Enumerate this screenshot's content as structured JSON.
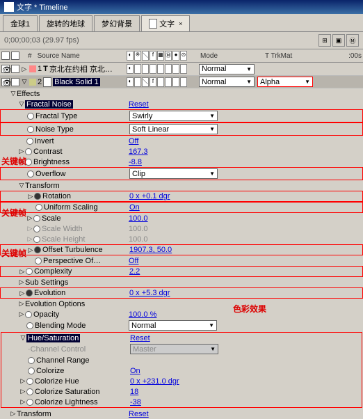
{
  "window": {
    "title": "文字 * Timeline"
  },
  "tabs": [
    {
      "label": "金球1"
    },
    {
      "label": "旋转的地球"
    },
    {
      "label": "梦幻背景"
    },
    {
      "label": "文字",
      "active": true
    }
  ],
  "timecode": {
    "value": "0;00;00;03",
    "fps": "(29.97 fps)"
  },
  "columns": {
    "source": "Source Name",
    "num": "#",
    "mode": "Mode",
    "trkmat": "T TrkMat",
    "time": ":00s"
  },
  "layers": [
    {
      "num": "1",
      "name": "京北在约相 京北…",
      "mode": "Normal",
      "trkmat": ""
    },
    {
      "num": "2",
      "name": "Black Solid 1",
      "mode": "Normal",
      "trkmat": "Alpha"
    }
  ],
  "effects_label": "Effects",
  "effects": {
    "fractal_noise": {
      "name": "Fractal Noise",
      "reset": "Reset"
    },
    "fractal_type": {
      "name": "Fractal Type",
      "value": "Swirly"
    },
    "noise_type": {
      "name": "Noise Type",
      "value": "Soft Linear"
    },
    "invert": {
      "name": "Invert",
      "value": "Off"
    },
    "contrast": {
      "name": "Contrast",
      "value": "167.3"
    },
    "brightness": {
      "name": "Brightness",
      "value": "-8.8"
    },
    "overflow": {
      "name": "Overflow",
      "value": "Clip"
    },
    "transform_group": "Transform",
    "rotation": {
      "name": "Rotation",
      "value": "0 x +0.1 dgr"
    },
    "uniform_scaling": {
      "name": "Uniform Scaling",
      "value": "On"
    },
    "scale": {
      "name": "Scale",
      "value": "100.0"
    },
    "scale_width": {
      "name": "Scale Width",
      "value": "100.0"
    },
    "scale_height": {
      "name": "Scale Height",
      "value": "100.0"
    },
    "offset_turbulence": {
      "name": "Offset Turbulence",
      "value": "1907.3, 50.0"
    },
    "perspective": {
      "name": "Perspective Of…",
      "value": "Off"
    },
    "complexity": {
      "name": "Complexity",
      "value": "2.2"
    },
    "sub_settings": "Sub Settings",
    "evolution": {
      "name": "Evolution",
      "value": "0 x +5.3 dgr"
    },
    "evolution_options": "Evolution Options",
    "opacity": {
      "name": "Opacity",
      "value": "100.0 %"
    },
    "blending_mode": {
      "name": "Blending Mode",
      "value": "Normal"
    },
    "hue_sat": {
      "name": "Hue/Saturation",
      "reset": "Reset"
    },
    "channel_control": {
      "name": "Channel Control",
      "value": "Master"
    },
    "channel_range": {
      "name": "Channel Range"
    },
    "colorize": {
      "name": "Colorize",
      "value": "On"
    },
    "colorize_hue": {
      "name": "Colorize Hue",
      "value": "0 x +231.0 dgr"
    },
    "colorize_saturation": {
      "name": "Colorize Saturation",
      "value": "18"
    },
    "colorize_lightness": {
      "name": "Colorize Lightness",
      "value": "-38"
    },
    "transform2": {
      "name": "Transform",
      "reset": "Reset"
    }
  },
  "annotations": {
    "keyframe": "关键帧",
    "color_effect": "色彩效果"
  }
}
